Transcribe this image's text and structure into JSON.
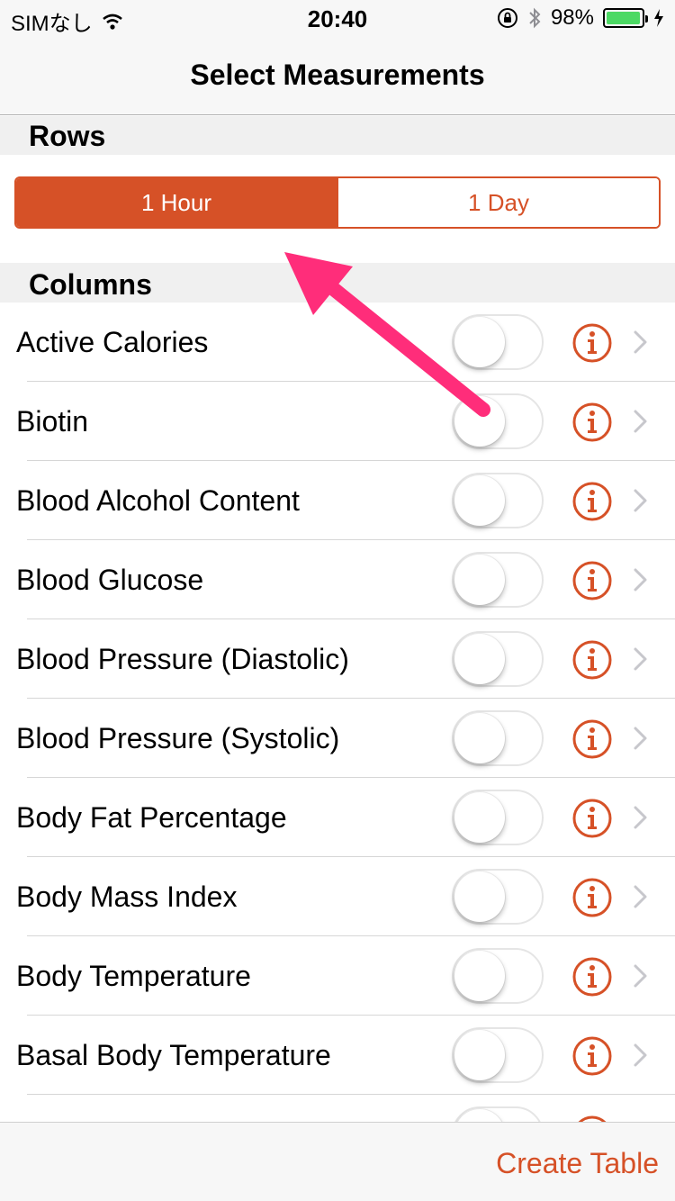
{
  "status_bar": {
    "carrier": "SIMなし",
    "time": "20:40",
    "battery_percent": "98%",
    "battery_level": 0.98,
    "icons": [
      "wifi-icon",
      "orientation-lock-icon",
      "bluetooth-icon",
      "battery-icon",
      "charging-icon"
    ]
  },
  "nav": {
    "title": "Select Measurements"
  },
  "rows_section": {
    "header": "Rows",
    "segments": [
      {
        "label": "1 Hour",
        "selected": true
      },
      {
        "label": "1 Day",
        "selected": false
      }
    ]
  },
  "columns_section": {
    "header": "Columns",
    "items": [
      {
        "label": "Active Calories",
        "enabled": false
      },
      {
        "label": "Biotin",
        "enabled": false
      },
      {
        "label": "Blood Alcohol Content",
        "enabled": false
      },
      {
        "label": "Blood Glucose",
        "enabled": false
      },
      {
        "label": "Blood Pressure (Diastolic)",
        "enabled": false
      },
      {
        "label": "Blood Pressure (Systolic)",
        "enabled": false
      },
      {
        "label": "Body Fat Percentage",
        "enabled": false
      },
      {
        "label": "Body Mass Index",
        "enabled": false
      },
      {
        "label": "Body Temperature",
        "enabled": false
      },
      {
        "label": "Basal Body Temperature",
        "enabled": false
      },
      {
        "label": "",
        "enabled": false
      }
    ]
  },
  "toolbar": {
    "create_label": "Create Table"
  },
  "colors": {
    "accent": "#d65127",
    "annotation_arrow": "#ff2d7a",
    "battery_green": "#4cd964",
    "chevron": "#c7c7cc"
  }
}
